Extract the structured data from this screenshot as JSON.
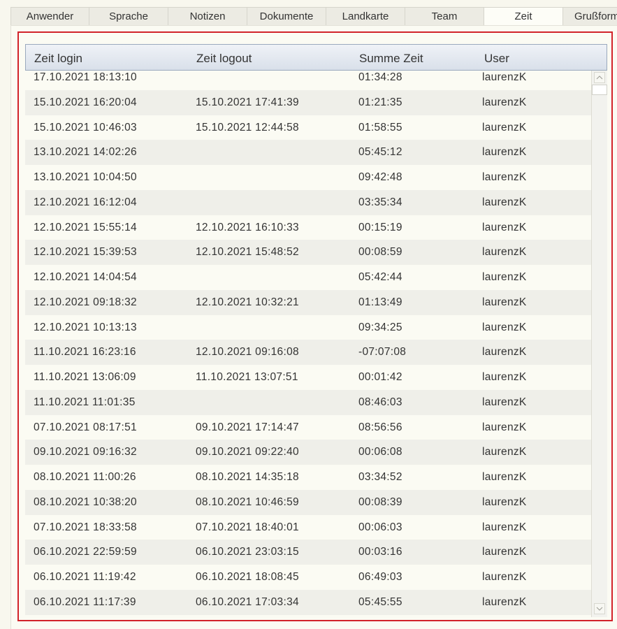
{
  "tabs": [
    {
      "label": "Anwender",
      "active": false
    },
    {
      "label": "Sprache",
      "active": false
    },
    {
      "label": "Notizen",
      "active": false
    },
    {
      "label": "Dokumente",
      "active": false
    },
    {
      "label": "Landkarte",
      "active": false
    },
    {
      "label": "Team",
      "active": false
    },
    {
      "label": "Zeit",
      "active": true
    },
    {
      "label": "Grußform",
      "active": false
    }
  ],
  "table": {
    "columns": [
      "Zeit login",
      "Zeit logout",
      "Summe Zeit",
      "User"
    ],
    "rows": [
      [
        "17.10.2021 18:13:10",
        "",
        "01:34:28",
        "laurenzK"
      ],
      [
        "15.10.2021 16:20:04",
        "15.10.2021 17:41:39",
        "01:21:35",
        "laurenzK"
      ],
      [
        "15.10.2021 10:46:03",
        "15.10.2021 12:44:58",
        "01:58:55",
        "laurenzK"
      ],
      [
        "13.10.2021 14:02:26",
        "",
        "05:45:12",
        "laurenzK"
      ],
      [
        "13.10.2021 10:04:50",
        "",
        "09:42:48",
        "laurenzK"
      ],
      [
        "12.10.2021 16:12:04",
        "",
        "03:35:34",
        "laurenzK"
      ],
      [
        "12.10.2021 15:55:14",
        "12.10.2021 16:10:33",
        "00:15:19",
        "laurenzK"
      ],
      [
        "12.10.2021 15:39:53",
        "12.10.2021 15:48:52",
        "00:08:59",
        "laurenzK"
      ],
      [
        "12.10.2021 14:04:54",
        "",
        "05:42:44",
        "laurenzK"
      ],
      [
        "12.10.2021 09:18:32",
        "12.10.2021 10:32:21",
        "01:13:49",
        "laurenzK"
      ],
      [
        "12.10.2021 10:13:13",
        "",
        "09:34:25",
        "laurenzK"
      ],
      [
        "11.10.2021 16:23:16",
        "12.10.2021 09:16:08",
        "-07:07:08",
        "laurenzK"
      ],
      [
        "11.10.2021 13:06:09",
        "11.10.2021 13:07:51",
        "00:01:42",
        "laurenzK"
      ],
      [
        "11.10.2021 11:01:35",
        "",
        "08:46:03",
        "laurenzK"
      ],
      [
        "07.10.2021 08:17:51",
        "09.10.2021 17:14:47",
        "08:56:56",
        "laurenzK"
      ],
      [
        "09.10.2021 09:16:32",
        "09.10.2021 09:22:40",
        "00:06:08",
        "laurenzK"
      ],
      [
        "08.10.2021 11:00:26",
        "08.10.2021 14:35:18",
        "03:34:52",
        "laurenzK"
      ],
      [
        "08.10.2021 10:38:20",
        "08.10.2021 10:46:59",
        "00:08:39",
        "laurenzK"
      ],
      [
        "07.10.2021 18:33:58",
        "07.10.2021 18:40:01",
        "00:06:03",
        "laurenzK"
      ],
      [
        "06.10.2021 22:59:59",
        "06.10.2021 23:03:15",
        "00:03:16",
        "laurenzK"
      ],
      [
        "06.10.2021 11:19:42",
        "06.10.2021 18:08:45",
        "06:49:03",
        "laurenzK"
      ],
      [
        "06.10.2021 11:17:39",
        "06.10.2021 17:03:34",
        "05:45:55",
        "laurenzK"
      ]
    ]
  },
  "colors": {
    "highlight_border": "#d2232a",
    "row_alt": "#efefe9",
    "row_base": "#fbfbf3",
    "header_border": "#9aa9bd"
  },
  "icons": {
    "scroll_up": "chevron-up-icon",
    "scroll_down": "chevron-down-icon"
  }
}
